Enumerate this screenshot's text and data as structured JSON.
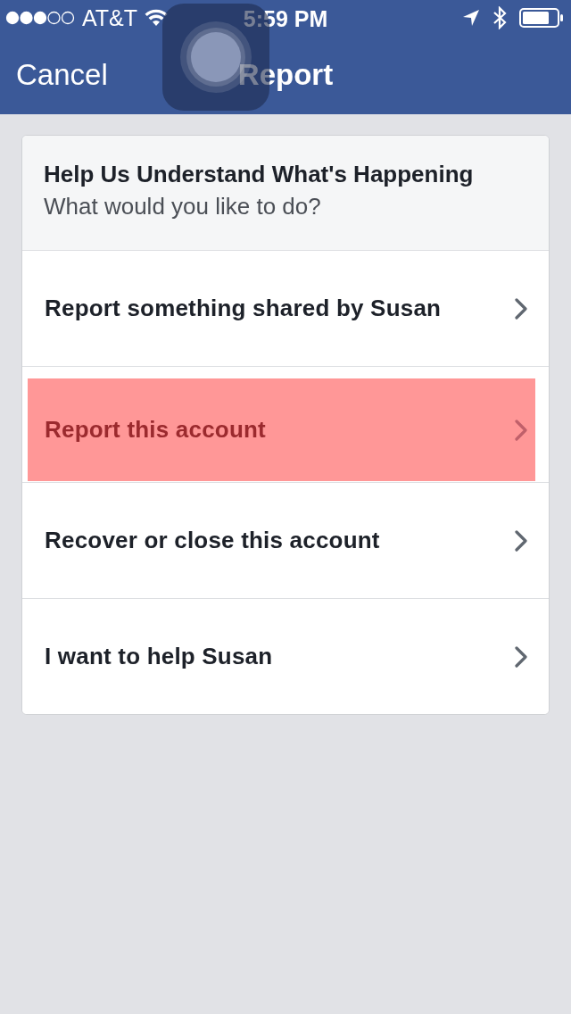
{
  "status_bar": {
    "carrier": "AT&T",
    "time": "5:59 PM"
  },
  "nav": {
    "cancel": "Cancel",
    "title": "Report"
  },
  "card": {
    "heading": "Help Us Understand What's Happening",
    "subheading": "What would you like to do?",
    "options": [
      {
        "label": "Report something shared by Susan",
        "highlighted": false
      },
      {
        "label": "Report this account",
        "highlighted": true
      },
      {
        "label": "Recover or close this account",
        "highlighted": false
      },
      {
        "label": "I want to help Susan",
        "highlighted": false
      }
    ]
  }
}
